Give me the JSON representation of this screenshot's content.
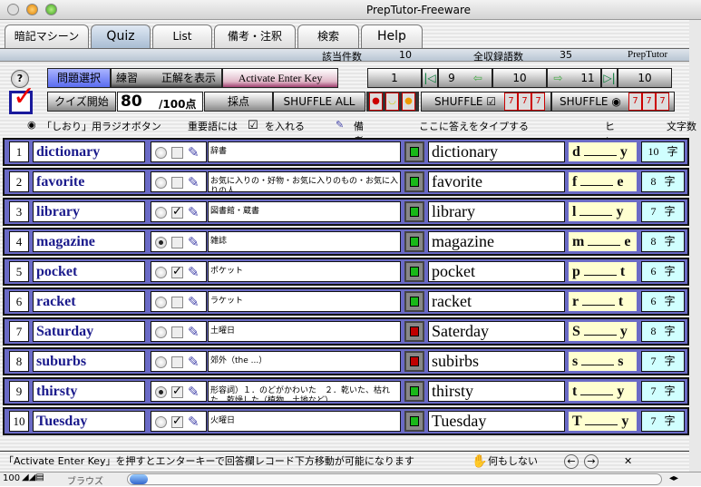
{
  "window": {
    "title": "PrepTutor-Freeware"
  },
  "tabs": [
    {
      "label": "暗記マシーン"
    },
    {
      "label": "Quiz"
    },
    {
      "label": "List"
    },
    {
      "label": "備考・注釈"
    },
    {
      "label": "検索"
    },
    {
      "label": "Help"
    }
  ],
  "info": {
    "match_label": "該当件数",
    "match_count": "10",
    "total_label": "全収録語数",
    "total_count": "35",
    "brand": "PrepTutor"
  },
  "toolbar": {
    "help": "?",
    "select_questions": "問題選択",
    "practice": "練習",
    "show_answer": "正解を表示",
    "activate_enter": "Activate Enter Key",
    "start_quiz": "クイズ開始",
    "score": "80",
    "score_max": "/100点",
    "grade": "採点",
    "shuffle_all": "SHUFFLE ALL",
    "shuffle_check": "SHUFFLE",
    "shuffle_radio": "SHUFFLE"
  },
  "navigation": {
    "first": "1",
    "prev": "9",
    "current": "10",
    "next": "11",
    "last": "10"
  },
  "headers": {
    "bookmark": "「しおり」用ラジオボタン",
    "important_pre": "重要語には",
    "important_post": "を入れる",
    "note": "備考",
    "answer": "ここに答えをタイプする",
    "hint": "ヒント",
    "count": "文字数"
  },
  "rows": [
    {
      "num": "1",
      "word": "dictionary",
      "note": "辞書",
      "answer": "dictionary",
      "hint_first": "d",
      "hint_last": "y",
      "count": "10",
      "count_unit": "字",
      "bookmarked": false,
      "important": false,
      "status": "#18b818"
    },
    {
      "num": "2",
      "word": "favorite",
      "note": "お気に入りの・好物・お気に入りのもの・お気に入りの人",
      "answer": "favorite",
      "hint_first": "f",
      "hint_last": "e",
      "count": "8",
      "count_unit": "字",
      "bookmarked": false,
      "important": false,
      "status": "#18b818"
    },
    {
      "num": "3",
      "word": "library",
      "note": "図書館・蔵書",
      "answer": "library",
      "hint_first": "l",
      "hint_last": "y",
      "count": "7",
      "count_unit": "字",
      "bookmarked": false,
      "important": true,
      "status": "#18b818"
    },
    {
      "num": "4",
      "word": "magazine",
      "note": "雑誌",
      "answer": "magazine",
      "hint_first": "m",
      "hint_last": "e",
      "count": "8",
      "count_unit": "字",
      "bookmarked": true,
      "important": false,
      "status": "#18b818"
    },
    {
      "num": "5",
      "word": "pocket",
      "note": "ポケット",
      "answer": "pocket",
      "hint_first": "p",
      "hint_last": "t",
      "count": "6",
      "count_unit": "字",
      "bookmarked": false,
      "important": true,
      "status": "#18b818"
    },
    {
      "num": "6",
      "word": "racket",
      "note": "ラケット",
      "answer": "racket",
      "hint_first": "r",
      "hint_last": "t",
      "count": "6",
      "count_unit": "字",
      "bookmarked": false,
      "important": false,
      "status": "#18b818"
    },
    {
      "num": "7",
      "word": "Saturday",
      "note": "土曜日",
      "answer": "Saterday",
      "hint_first": "S",
      "hint_last": "y",
      "count": "8",
      "count_unit": "字",
      "bookmarked": false,
      "important": false,
      "status": "#c00000"
    },
    {
      "num": "8",
      "word": "suburbs",
      "note": "郊外（the ...）",
      "answer": "subirbs",
      "hint_first": "s",
      "hint_last": "s",
      "count": "7",
      "count_unit": "字",
      "bookmarked": false,
      "important": false,
      "status": "#c00000"
    },
    {
      "num": "9",
      "word": "thirsty",
      "note": "形容詞）１．のどがかわいた　２．乾いた、枯れた、乾燥した（植物、土地など）",
      "answer": "thirsty",
      "hint_first": "t",
      "hint_last": "y",
      "count": "7",
      "count_unit": "字",
      "bookmarked": true,
      "important": true,
      "status": "#18b818"
    },
    {
      "num": "10",
      "word": "Tuesday",
      "note": "火曜日",
      "answer": "Tuesday",
      "hint_first": "T",
      "hint_last": "y",
      "count": "7",
      "count_unit": "字",
      "bookmarked": false,
      "important": true,
      "status": "#18b818"
    }
  ],
  "footer": {
    "message": "「Activate Enter Key」を押すとエンターキーで回答欄レコード下方移動が可能になります",
    "do_nothing": "何もしない"
  },
  "statusbar": {
    "zoom": "100",
    "mode": "ブラウズ"
  }
}
